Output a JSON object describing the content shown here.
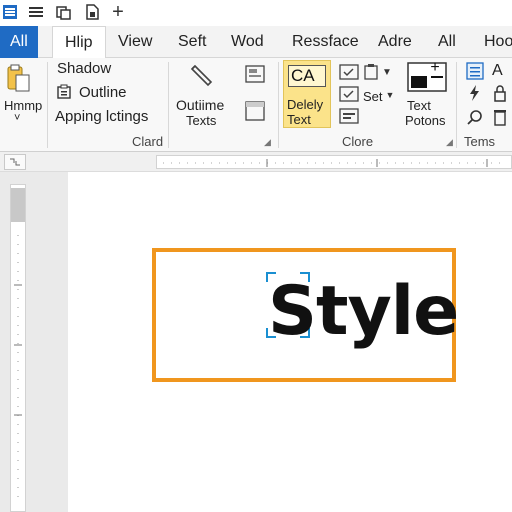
{
  "colors": {
    "accent_blue": "#1f6bc4",
    "orange_frame": "#f0961e",
    "highlight_yellow": "#fbe38a"
  },
  "quick_access": {
    "icons": [
      "hamburger-menu-icon",
      "list-icon",
      "copy-icon",
      "document-icon",
      "plus-icon"
    ],
    "plus_glyph": "+"
  },
  "tabs": [
    "All",
    "Hlip",
    "View",
    "Seft",
    "Wod",
    "Ressface",
    "Adre",
    "All",
    "Hoo"
  ],
  "ribbon": {
    "paste_label": "Hmmp",
    "paste_caret": "˅",
    "font_group": {
      "shadow": "Shadow",
      "outline": "Outline",
      "apping": "Apping lctings",
      "label": "Clard"
    },
    "outline_btn": {
      "line1": "Outiime",
      "line2": "Texts"
    },
    "deley_btn": {
      "line1": "Delely",
      "line2": "Text",
      "badge": "CA"
    },
    "clore_group": {
      "set_label": "Set",
      "label": "Clore"
    },
    "text_potons": {
      "line1": "Text",
      "line2": "Potons",
      "plus": "+"
    },
    "tems_group": {
      "a_glyph": "A",
      "label": "Tems"
    }
  },
  "document": {
    "styled_text": "Style"
  }
}
